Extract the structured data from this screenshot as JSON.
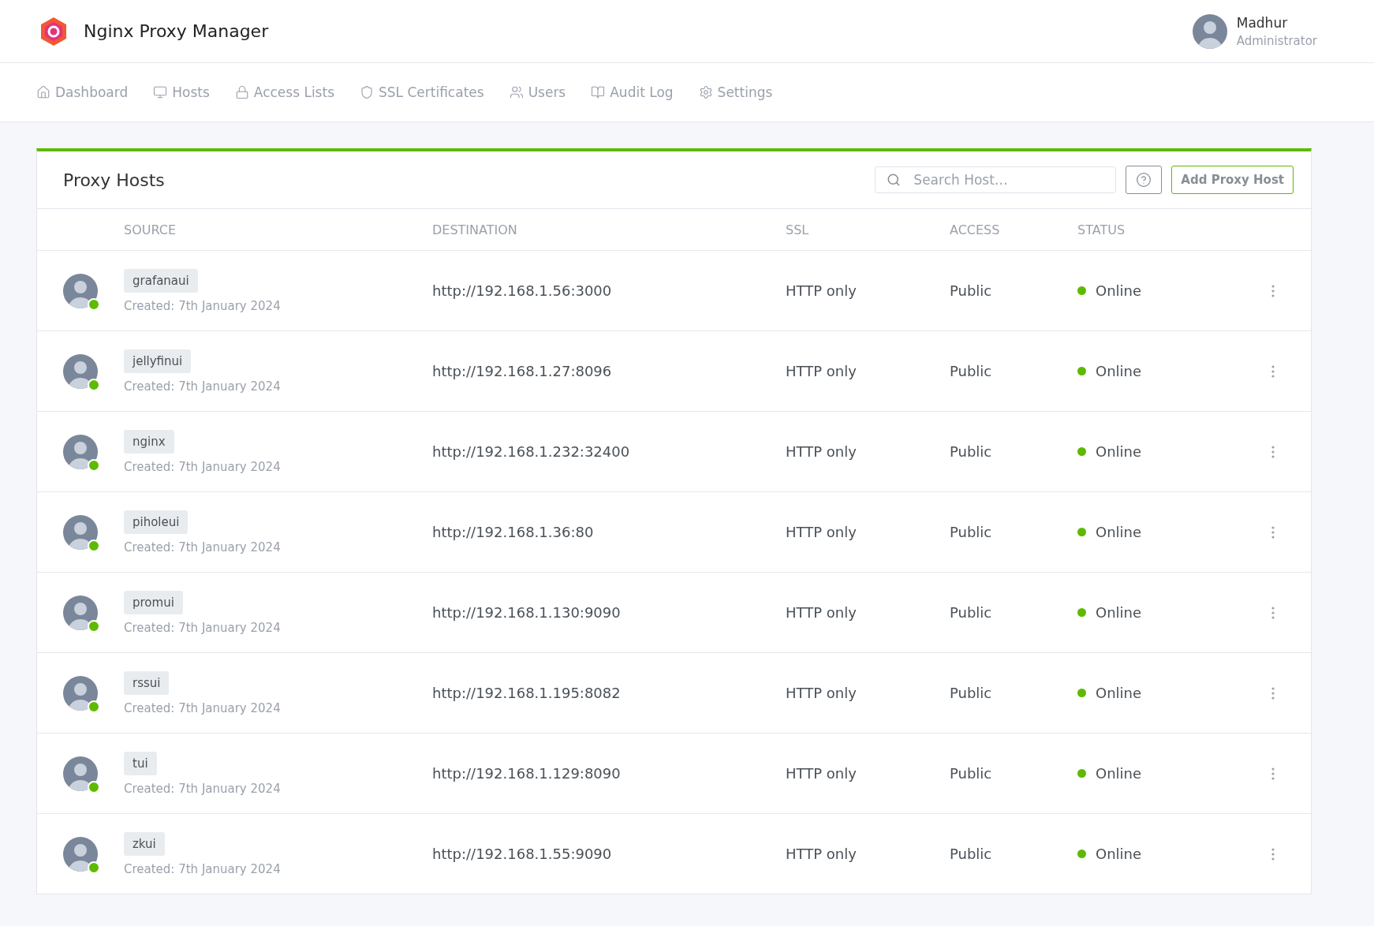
{
  "app": {
    "title": "Nginx Proxy Manager"
  },
  "user": {
    "name": "Madhur",
    "role": "Administrator"
  },
  "nav": [
    {
      "label": "Dashboard",
      "selected": false
    },
    {
      "label": "Hosts",
      "selected": false
    },
    {
      "label": "Access Lists",
      "selected": false
    },
    {
      "label": "SSL Certificates",
      "selected": false
    },
    {
      "label": "Users",
      "selected": false
    },
    {
      "label": "Audit Log",
      "selected": false
    },
    {
      "label": "Settings",
      "selected": false
    }
  ],
  "card": {
    "title": "Proxy Hosts",
    "search_placeholder": "Search Host…",
    "add_button": "Add Proxy Host"
  },
  "table": {
    "columns": [
      "SOURCE",
      "DESTINATION",
      "SSL",
      "ACCESS",
      "STATUS"
    ],
    "rows": [
      {
        "source": "grafanaui",
        "created": "Created: 7th January 2024",
        "destination": "http://192.168.1.56:3000",
        "ssl": "HTTP only",
        "access": "Public",
        "status": "Online",
        "online": true
      },
      {
        "source": "jellyfinui",
        "created": "Created: 7th January 2024",
        "destination": "http://192.168.1.27:8096",
        "ssl": "HTTP only",
        "access": "Public",
        "status": "Online",
        "online": true
      },
      {
        "source": "nginx",
        "created": "Created: 7th January 2024",
        "destination": "http://192.168.1.232:32400",
        "ssl": "HTTP only",
        "access": "Public",
        "status": "Online",
        "online": true
      },
      {
        "source": "piholeui",
        "created": "Created: 7th January 2024",
        "destination": "http://192.168.1.36:80",
        "ssl": "HTTP only",
        "access": "Public",
        "status": "Online",
        "online": true
      },
      {
        "source": "promui",
        "created": "Created: 7th January 2024",
        "destination": "http://192.168.1.130:9090",
        "ssl": "HTTP only",
        "access": "Public",
        "status": "Online",
        "online": true
      },
      {
        "source": "rssui",
        "created": "Created: 7th January 2024",
        "destination": "http://192.168.1.195:8082",
        "ssl": "HTTP only",
        "access": "Public",
        "status": "Online",
        "online": true
      },
      {
        "source": "tui",
        "created": "Created: 7th January 2024",
        "destination": "http://192.168.1.129:8090",
        "ssl": "HTTP only",
        "access": "Public",
        "status": "Online",
        "online": true
      },
      {
        "source": "zkui",
        "created": "Created: 7th January 2024",
        "destination": "http://192.168.1.55:9090",
        "ssl": "HTTP only",
        "access": "Public",
        "status": "Online",
        "online": true
      }
    ]
  }
}
